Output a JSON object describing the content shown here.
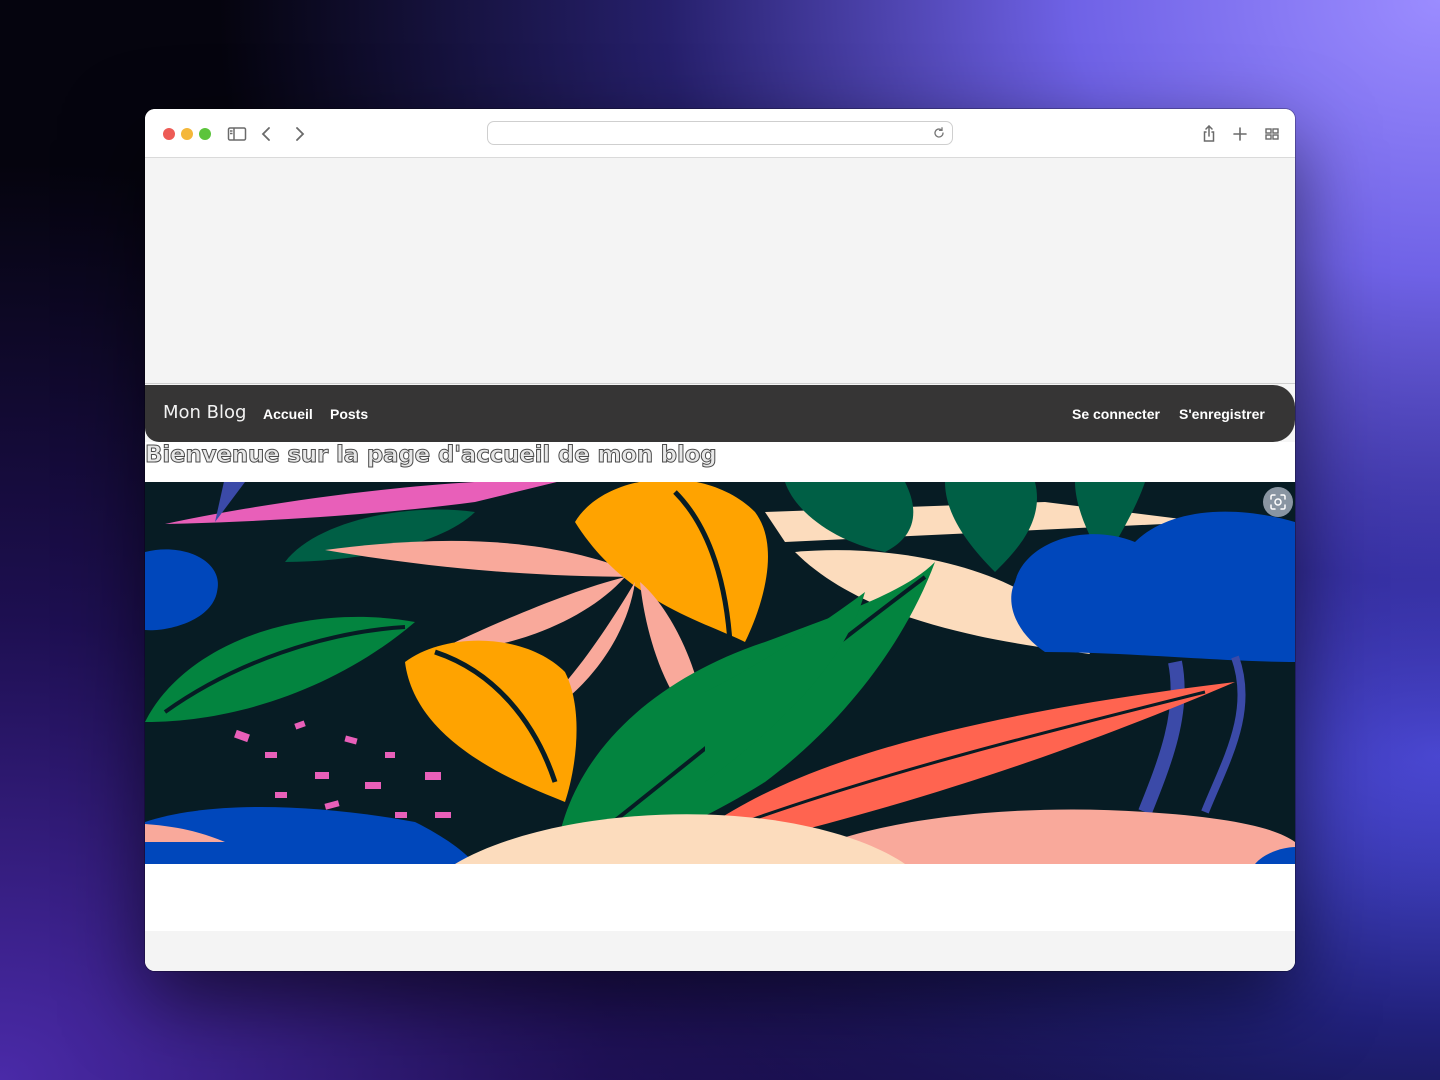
{
  "browser": {
    "address_text": "",
    "icons": [
      "sidebar-icon",
      "back-icon",
      "forward-icon",
      "reload-icon",
      "share-icon",
      "new-tab-icon",
      "tab-overview-icon"
    ]
  },
  "site": {
    "brand": "Mon Blog",
    "nav_left": [
      "Accueil",
      "Posts"
    ],
    "nav_right": [
      "Se connecter",
      "S'enregistrer"
    ],
    "navbar_color": "#363535"
  },
  "main": {
    "welcome_title": "Bienvenue sur la page d'accueil de mon blog",
    "hero_palette": [
      "#071c24",
      "#0047bb",
      "#e85fb9",
      "#ffa300",
      "#f9a99b",
      "#03843f",
      "#ff6450",
      "#fcdcbd",
      "#005f45"
    ]
  }
}
